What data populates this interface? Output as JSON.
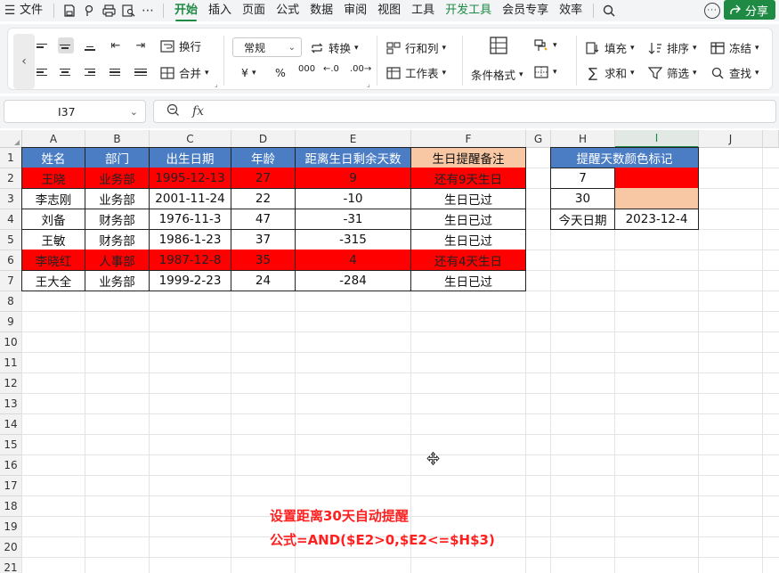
{
  "menubar": {
    "file_label": "文件",
    "tabs": [
      "开始",
      "插入",
      "页面",
      "公式",
      "数据",
      "审阅",
      "视图",
      "工具",
      "开发工具",
      "会员专享",
      "效率"
    ],
    "share_label": "分享"
  },
  "ribbon": {
    "wrap_label": "换行",
    "merge_label": "合并",
    "number_format": "常规",
    "convert_label": "转换",
    "rowcol_label": "行和列",
    "sheet_label": "工作表",
    "cond_format_label": "条件格式",
    "fill_label": "填充",
    "sort_label": "排序",
    "freeze_label": "冻结",
    "sum_label": "求和",
    "filter_label": "筛选",
    "find_label": "查找",
    "currency_symbol": "¥",
    "percent_symbol": "%",
    "thousands_symbol": "000"
  },
  "formula_bar": {
    "cell_ref": "I37",
    "fx": "fx",
    "content": ""
  },
  "columns": [
    "A",
    "B",
    "C",
    "D",
    "E",
    "F",
    "G",
    "H",
    "I",
    "J"
  ],
  "rows": [
    "1",
    "2",
    "3",
    "4",
    "5",
    "6",
    "7",
    "8",
    "9",
    "10",
    "11",
    "12",
    "13",
    "14",
    "15",
    "16",
    "17",
    "18",
    "19",
    "20",
    "21"
  ],
  "table": {
    "headers": [
      "姓名",
      "部门",
      "出生日期",
      "年龄",
      "距离生日剩余天数",
      "生日提醒备注"
    ],
    "rows": [
      [
        "王晓",
        "业务部",
        "1995-12-13",
        "27",
        "9",
        "还有9天生日"
      ],
      [
        "李志刚",
        "业务部",
        "2001-11-24",
        "22",
        "-10",
        "生日已过"
      ],
      [
        "刘备",
        "财务部",
        "1976-11-3",
        "47",
        "-31",
        "生日已过"
      ],
      [
        "王敏",
        "财务部",
        "1986-1-23",
        "37",
        "-315",
        "生日已过"
      ],
      [
        "李晓红",
        "人事部",
        "1987-12-8",
        "35",
        "4",
        "还有4天生日"
      ],
      [
        "王大全",
        "业务部",
        "1999-2-23",
        "24",
        "-284",
        "生日已过"
      ]
    ],
    "highlight_color": "#ff0000"
  },
  "side_table": {
    "title": "提醒天数颜色标记",
    "rows": [
      {
        "label": "7",
        "value": ""
      },
      {
        "label": "30",
        "value": ""
      },
      {
        "label": "今天日期",
        "value": "2023-12-4"
      }
    ],
    "color_7": "#ff0000",
    "color_30": "#f7c8a3"
  },
  "annotation": {
    "line1": "设置距离30天自动提醒",
    "line2": "公式=AND($E2>0,$E2<=$H$3)",
    "color": "#ff2020"
  }
}
